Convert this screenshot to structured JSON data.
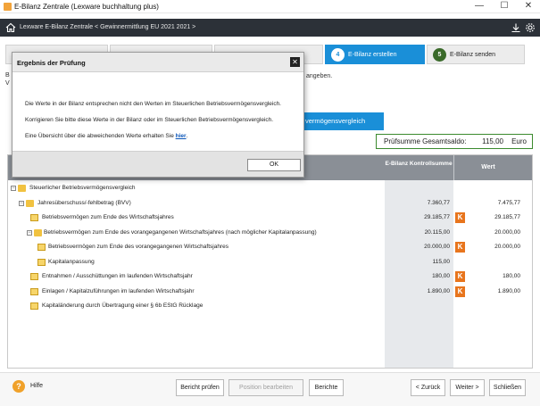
{
  "window": {
    "title": "E-Bilanz Zentrale (Lexware buchhaltung plus)",
    "controls": {
      "minimize": "—",
      "maximize": "☐",
      "close": "✕"
    }
  },
  "header": {
    "breadcrumb": "Lexware E-Bilanz Zentrale < Gewinnermittlung EU 2021 2021 >"
  },
  "stepper": {
    "steps": [
      {
        "num": "4",
        "label": "E-Bilanz erstellen",
        "state": "active"
      },
      {
        "num": "5",
        "label": "E-Bilanz senden",
        "state": "next"
      }
    ]
  },
  "background": {
    "hint_text": "angeben.",
    "left_letter_1": "B",
    "left_letter_2": "V",
    "tab_label": "vermögensvergleich"
  },
  "checksum": {
    "label": "Prüfsumme Gesamtsaldo:",
    "value": "115,00",
    "currency": "Euro"
  },
  "table": {
    "col_kontroll": "E-Bilanz Kontrollsumme",
    "col_wert": "Wert",
    "rows": [
      {
        "label": "Steuerlicher Betriebsvermögensvergleich",
        "kontroll": "",
        "wert": "",
        "k": ""
      },
      {
        "label": "Jahresüberschuss/-fehlbetrag (BVV)",
        "kontroll": "7.360,77",
        "wert": "7.475,77",
        "k": ""
      },
      {
        "label": "Betriebsvermögen zum Ende des Wirtschaftsjahres",
        "kontroll": "29.185,77",
        "wert": "29.185,77",
        "k": "K"
      },
      {
        "label": "Betriebsvermögen zum Ende des vorangegangenen Wirtschaftsjahres (nach möglicher Kapitalanpassung)",
        "kontroll": "20.115,00",
        "wert": "20.000,00",
        "k": ""
      },
      {
        "label": "Betriebsvermögen zum Ende des vorangegangenen Wirtschaftsjahres",
        "kontroll": "20.000,00",
        "wert": "20.000,00",
        "k": "K"
      },
      {
        "label": "Kapitalanpassung",
        "kontroll": "115,00",
        "wert": "",
        "k": ""
      },
      {
        "label": "Entnahmen / Ausschüttungen im laufenden Wirtschaftsjahr",
        "kontroll": "180,00",
        "wert": "180,00",
        "k": "K"
      },
      {
        "label": "Einlagen / Kapitalzuführungen im laufenden Wirtschaftsjahr",
        "kontroll": "1.890,00",
        "wert": "1.890,00",
        "k": "K"
      },
      {
        "label": "Kapitaländerung durch Übertragung einer § 6b EStG Rücklage",
        "kontroll": "",
        "wert": "",
        "k": ""
      }
    ]
  },
  "footer": {
    "help": "Hilfe",
    "help_glyph": "?",
    "buttons": {
      "report_check": "Bericht prüfen",
      "edit_position": "Position bearbeiten",
      "reports": "Berichte",
      "back": "< Zurück",
      "next": "Weiter >",
      "close": "Schließen"
    }
  },
  "dialog": {
    "title": "Ergebnis der Prüfung",
    "line1": "Die Werte in der Bilanz entsprechen nicht den Werten im Steuerlichen Betriebsvermögensvergleich.",
    "line2": "Korrigieren Sie bitte diese Werte in der Bilanz oder im Steuerlichen Betriebsvermögensvergleich.",
    "line3": "Eine Übersicht über die abweichenden Werte erhalten Sie",
    "link": "hier",
    "link_suffix": ".",
    "ok": "OK",
    "close_glyph": "✕"
  },
  "colors": {
    "header_bg": "#2c3138",
    "active_step": "#1a8fd8",
    "checksum_border": "#3b8a2e",
    "k_badge": "#e8751d",
    "table_header": "#8a8f96"
  }
}
